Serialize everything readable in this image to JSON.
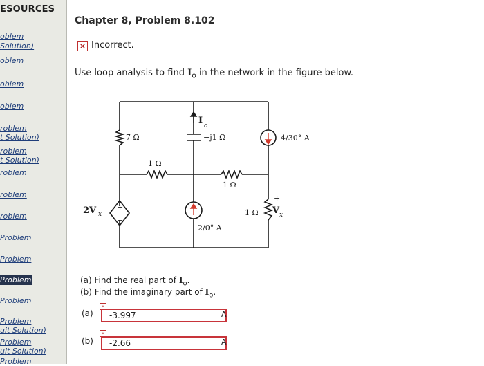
{
  "sidebar": {
    "title": "ESOURCES",
    "items": [
      {
        "label": "oblem"
      },
      {
        "label": "Solution)"
      },
      {
        "label": "oblem"
      },
      {
        "label": "oblem"
      },
      {
        "label": "oblem"
      },
      {
        "label": "roblem"
      },
      {
        "label": "t Solution)"
      },
      {
        "label": "roblem"
      },
      {
        "label": "t Solution)"
      },
      {
        "label": "roblem"
      },
      {
        "label": "roblem"
      },
      {
        "label": "roblem"
      },
      {
        "label": "Problem"
      },
      {
        "label": "Problem"
      },
      {
        "label": "Problem"
      },
      {
        "label": "Problem"
      },
      {
        "label": "Problem"
      },
      {
        "label": "uit Solution)"
      },
      {
        "label": "Problem"
      },
      {
        "label": "uit Solution)"
      },
      {
        "label": "Problem"
      }
    ]
  },
  "main": {
    "title": "Chapter 8, Problem 8.102",
    "result": {
      "icon": "x-mark-icon",
      "text": "Incorrect."
    },
    "question": {
      "prefix": "Use loop analysis to find ",
      "var": "I",
      "sub": "o",
      "suffix": " in the network in the figure below."
    }
  },
  "circuit": {
    "r1": "7 Ω",
    "cap": "−j1 Ω",
    "r2": "1 Ω",
    "r3": "1 Ω",
    "r4": "1 Ω",
    "isrc1": "4/30° A",
    "isrc2": "2/0° A",
    "vsrc": "2V",
    "vsrc_sub": "x",
    "vx_label": "V",
    "vx_sub": "x",
    "io_label": "I",
    "io_sub": "o",
    "plus": "+",
    "minus": "−"
  },
  "parts": {
    "a_text": "(a) Find the real part of ",
    "b_text": "(b) Find the imaginary part of ",
    "var": "I",
    "sub": "o",
    "end": "."
  },
  "answers": [
    {
      "label": "(a)",
      "value": "-3.997",
      "unit": "A",
      "flag": "×"
    },
    {
      "label": "(b)",
      "value": "-2.66",
      "unit": "A",
      "flag": "×"
    }
  ]
}
